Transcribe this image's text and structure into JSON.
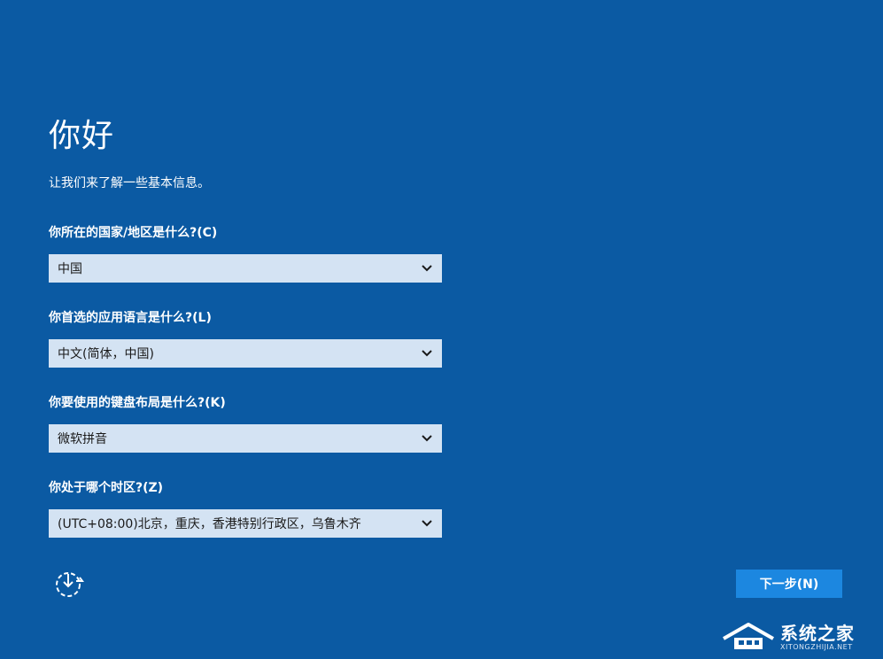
{
  "header": {
    "title": "你好",
    "subtitle": "让我们来了解一些基本信息。"
  },
  "fields": [
    {
      "label": "你所在的国家/地区是什么?(C)",
      "value": "中国"
    },
    {
      "label": "你首选的应用语言是什么?(L)",
      "value": "中文(简体，中国)"
    },
    {
      "label": "你要使用的键盘布局是什么?(K)",
      "value": "微软拼音"
    },
    {
      "label": "你处于哪个时区?(Z)",
      "value": "(UTC+08:00)北京，重庆，香港特别行政区，乌鲁木齐"
    }
  ],
  "footer": {
    "next_label": "下一步(N)",
    "accessibility_icon": "ease-of-access-icon"
  },
  "watermark": {
    "brand": "系统之家",
    "url": "XITONGZHIJIA.NET"
  },
  "colors": {
    "background": "#0b5aa3",
    "dropdown": "#d4e3f3",
    "button": "#1c87e0"
  }
}
